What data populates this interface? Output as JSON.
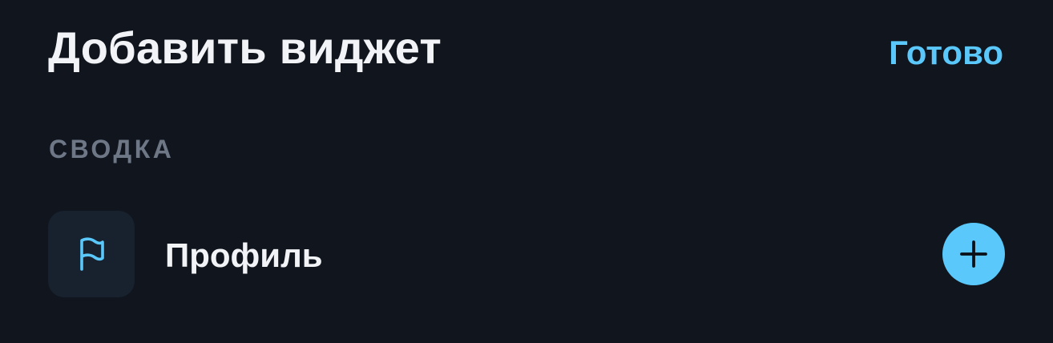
{
  "header": {
    "title": "Добавить виджет",
    "done_label": "Готово"
  },
  "section": {
    "header": "СВОДКА"
  },
  "items": [
    {
      "label": "Профиль",
      "icon": "flag-icon",
      "action_icon": "plus-icon"
    }
  ],
  "colors": {
    "background": "#11151e",
    "accent": "#5ac8fa",
    "section_header": "#6e7786",
    "icon_tile": "#17222e",
    "text": "#f1f3f6"
  }
}
